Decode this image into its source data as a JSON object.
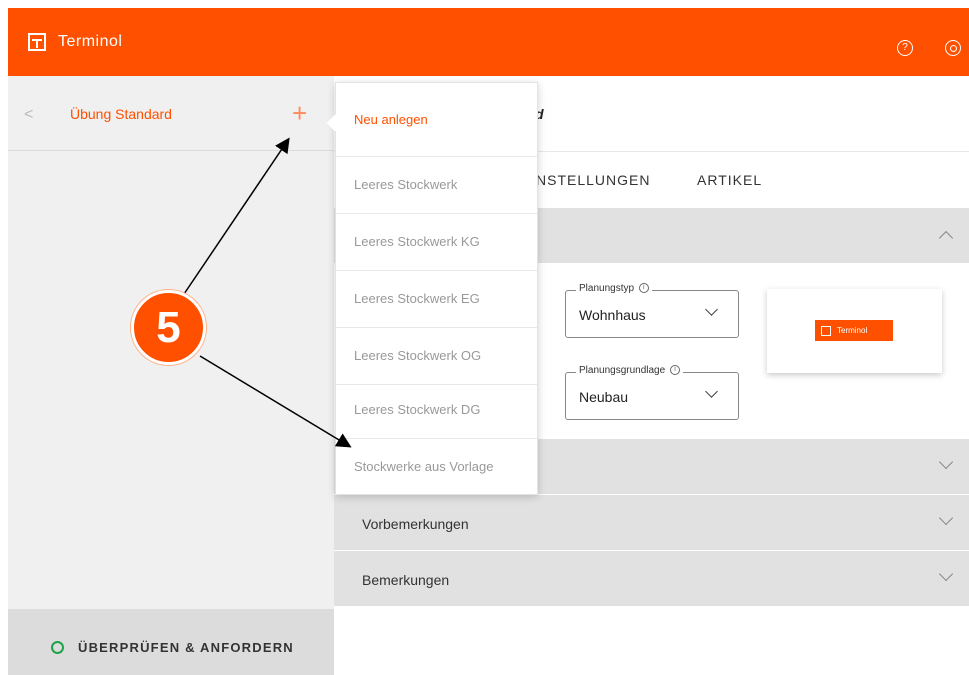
{
  "header": {
    "brand": "Terminol",
    "help_icon": "help-circle-icon",
    "settings_icon": "settings-icon",
    "accent_color": "#ff5000"
  },
  "sidebar": {
    "back_icon": "chevron-left-icon",
    "project_name": "Übung Standard",
    "add_icon": "plus-icon",
    "footer_label": "ÜBERPRÜFEN & ANFORDERN",
    "status_color": "#1ea34a"
  },
  "content": {
    "title_fragment": "d",
    "tabs": [
      "NSTELLUNGEN",
      "ARTIKEL"
    ],
    "fields": {
      "planning_type": {
        "label": "Planungstyp",
        "value": "Wohnhaus"
      },
      "planning_basis": {
        "label": "Planungsgrundlage",
        "value": "Neubau"
      }
    },
    "preview_logo": "Terminol",
    "panels": [
      "",
      "",
      "Vorbemerkungen",
      "Bemerkungen"
    ]
  },
  "dropdown": {
    "items": [
      "Neu anlegen",
      "Leeres Stockwerk",
      "Leeres Stockwerk KG",
      "Leeres Stockwerk EG",
      "Leeres Stockwerk OG",
      "Leeres Stockwerk DG",
      "Stockwerke aus Vorlage"
    ]
  },
  "annotation": {
    "number": "5"
  }
}
